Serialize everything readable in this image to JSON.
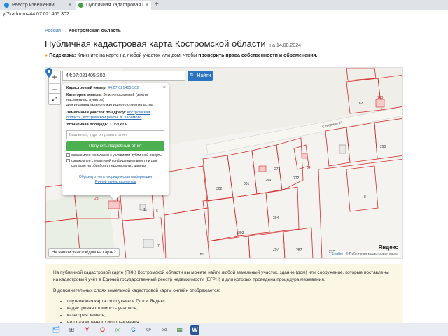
{
  "browser": {
    "tabs": [
      {
        "label": "Реестр извещений",
        "active": false
      },
      {
        "label": "Публичная кадастровая карта Ко",
        "active": true
      }
    ],
    "new_tab": "+",
    "close_tab": "×",
    "address": "y/?kadnum=44:07:021405:302"
  },
  "breadcrumb": {
    "root": "Россия",
    "sep": "→",
    "current": "Костромская область"
  },
  "page": {
    "title": "Публичная кадастровая карта Костромской области",
    "date": "на 14.08.2024",
    "hint_label": "Подсказка:",
    "hint_text": " Кликните на карте на любой участок или дом, чтобы ",
    "hint_bold": "проверить права собственности и обременения."
  },
  "map": {
    "zoom_in": "+",
    "zoom_out": "−",
    "fullscreen": "⤢",
    "search_value": "44:07:021405:302",
    "search_button": "Найти",
    "not_found": "Не нашли участок/дом на карте?",
    "attribution": "Leaflet | © Публичная кадастровая карта",
    "attribution_prefix": "Leaflet",
    "attribution_rest": " | © Публичная кадастровая карта",
    "yandex": "Яндекс",
    "street": "Северная ул.",
    "plot_labels": {
      "p302": "302",
      "p301": "301",
      "p299": "299",
      "p272": "272",
      "p34": "34",
      "p303": "303",
      "p304": "304",
      "p297": "297",
      "p287": "287",
      "p262": "262",
      "p290": "290",
      "p8": "8",
      "p11": "11",
      "p23": "23",
      "p6": "6",
      "p7": "7",
      "p181": "181",
      "p163": "163",
      "p182": "182",
      "p273": "273"
    },
    "popup": {
      "close": "×",
      "cad_label": "Кадастровый номер:",
      "cad_value": "44:07:021405:302",
      "cat_label": "Категория земель:",
      "cat_value": "Земли поселений (земли населенных пунктов)",
      "use_value": "для индивидуального жилищного строительства",
      "addr_label": "Земельный участок по адресу:",
      "addr_value": "Костромская область, Костромской район, д. Каримово",
      "area_label": "Уточненная площадь:",
      "area_value": "1 059 кв.м.",
      "email_placeholder": "Ваш email, куда отправить отчет",
      "get_report": "Получить подробный отчет",
      "consent1": "ознакомлен и согласен с условиями публичной оферты",
      "consent2": "ознакомлен с политикой конфиденциальности и даю согласие на обработку персональных данных",
      "sample_link": "Образец отчета и юридическая информация",
      "manual_link": "Ручной выбор вариантов"
    }
  },
  "info": {
    "para1": "На публичной кадастровой карте (ПКК) Костромской области вы можете найти любой земельный участок, здание (дом) или сооружение, которые поставлены на кадастровый учёт в Единый государственный реестр недвижимости (ЕГРН) и для которых проведена процедура межевания.",
    "para2": "В дополнительных слоях земельной кадастровой карты онлайн отображается:",
    "items": [
      "спутниковая карта со спутников Гугл и Яндекс",
      "кадастровая стоимость участков;",
      "категория земель;",
      "вид разрешенного использования."
    ]
  },
  "taskbar": {
    "apps": [
      "⊞",
      "🗂",
      "Y",
      "O",
      "◎",
      "C",
      "⟳",
      "✉",
      "▦",
      "W"
    ]
  },
  "colors": {
    "accent": "#2a74c2",
    "green": "#4caf50",
    "parcel_border": "#d32f2f",
    "info_bg": "#fcf6e4"
  }
}
